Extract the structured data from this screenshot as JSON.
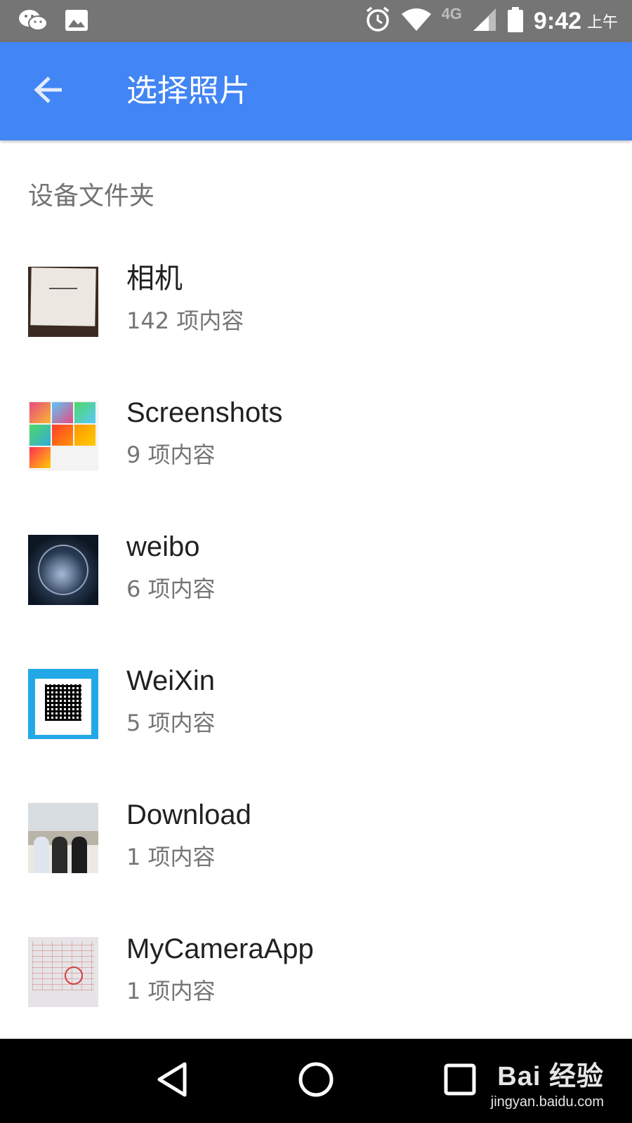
{
  "status_bar": {
    "time": "9:42",
    "ampm": "上午",
    "network": "4G",
    "icons": [
      "wechat-icon",
      "image-icon",
      "alarm-icon",
      "wifi-icon",
      "signal-icon",
      "battery-icon"
    ]
  },
  "app_bar": {
    "title": "选择照片",
    "back_icon": "arrow-back-icon",
    "background": "#4285f4"
  },
  "section": {
    "header": "设备文件夹"
  },
  "folders": [
    {
      "name": "相机",
      "count": "142 项内容"
    },
    {
      "name": "Screenshots",
      "count": "9 项内容"
    },
    {
      "name": "weibo",
      "count": "6 项内容"
    },
    {
      "name": "WeiXin",
      "count": "5 项内容"
    },
    {
      "name": "Download",
      "count": "1 项内容"
    },
    {
      "name": "MyCameraApp",
      "count": "1 项内容"
    }
  ],
  "nav_bar": {
    "buttons": [
      "back-triangle-icon",
      "home-circle-icon",
      "recents-square-icon"
    ]
  },
  "watermark": {
    "brand": "Bai 经验",
    "url": "jingyan.baidu.com"
  }
}
